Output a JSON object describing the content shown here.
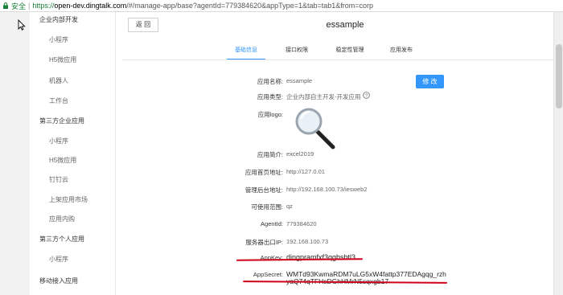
{
  "browser": {
    "secure_label": "安全",
    "url_scheme": "https://",
    "url_host": "open-dev.dingtalk.com",
    "url_rest": "/#/manage-app/base?agentId=779384620&appType=1&tab=tab1&from=corp"
  },
  "sidebar": {
    "items": [
      {
        "label": "企业内部开发",
        "kind": "group"
      },
      {
        "label": "小程序",
        "kind": "sub"
      },
      {
        "label": "H5微应用",
        "kind": "sub"
      },
      {
        "label": "机器人",
        "kind": "sub"
      },
      {
        "label": "工作台",
        "kind": "sub"
      },
      {
        "label": "第三方企业应用",
        "kind": "group"
      },
      {
        "label": "小程序",
        "kind": "sub"
      },
      {
        "label": "H5微应用",
        "kind": "sub"
      },
      {
        "label": "钉钉云",
        "kind": "sub"
      },
      {
        "label": "上架应用市场",
        "kind": "sub"
      },
      {
        "label": "应用内购",
        "kind": "sub"
      },
      {
        "label": "第三方个人应用",
        "kind": "group"
      },
      {
        "label": "小程序",
        "kind": "sub"
      },
      {
        "label": "移动接入应用",
        "kind": "group"
      }
    ]
  },
  "header": {
    "back_label": "返 回",
    "title": "essample"
  },
  "tabs": [
    {
      "label": "基础信息",
      "active": true
    },
    {
      "label": "接口权限",
      "active": false
    },
    {
      "label": "稳定性管理",
      "active": false
    },
    {
      "label": "应用发布",
      "active": false
    }
  ],
  "info": {
    "edit_label": "修 改",
    "name_label": "应用名称:",
    "name_value": "essample",
    "type_label": "应用类型:",
    "type_value": "企业内部自主开发-开发应用",
    "logo_label": "应用logo:",
    "desc_label": "应用简介:",
    "desc_value": "excel2019",
    "home_label": "应用首页地址:",
    "home_value": "http://127.0.01",
    "admin_label": "管理后台地址:",
    "admin_value": "http://192.168.100.73/iesweb2",
    "scope_label": "可使用范围:",
    "scope_value": "qz",
    "agentid_label": "AgentId:",
    "agentid_value": "779384620",
    "ip_label": "服务器出口IP:",
    "ip_value": "192.168.100.73",
    "appkey_label": "AppKey:",
    "appkey_value": "dingpramfxf3qgbsbtl3",
    "secret_label": "AppSecret:",
    "secret_line1": "WMTd93KwmaRDM7uLG5xW4fattp377EDAgqg_rzh",
    "secret_line2": "yaQ74qTFHsDGhHMrN5sqxgb17"
  },
  "colors": {
    "accent": "#3296fa",
    "annotation_red": "#d0021b"
  }
}
